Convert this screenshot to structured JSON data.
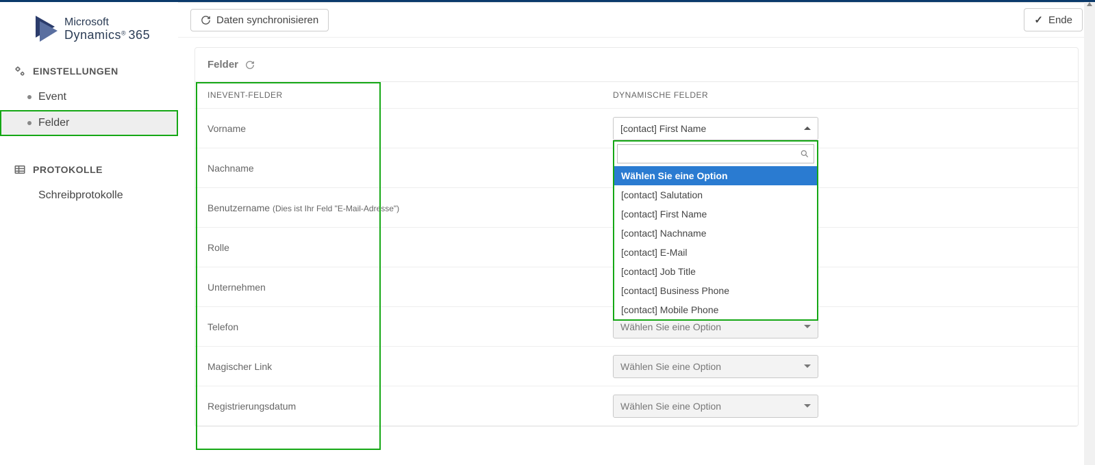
{
  "logo": {
    "line1": "Microsoft",
    "line2": "Dynamics",
    "line3": "365"
  },
  "sidebar": {
    "section1": {
      "title": "EINSTELLUNGEN",
      "items": [
        "Event",
        "Felder"
      ]
    },
    "section2": {
      "title": "PROTOKOLLE",
      "items": [
        "Schreibprotokolle"
      ]
    }
  },
  "toolbar": {
    "sync": "Daten synchronisieren",
    "end": "Ende"
  },
  "panel": {
    "title": "Felder",
    "col_left": "INEVENT-FELDER",
    "col_right": "DYNAMISCHE FELDER",
    "rows": [
      {
        "label": "Vorname",
        "value": "[contact] First Name",
        "open": true
      },
      {
        "label": "Nachname"
      },
      {
        "label": "Benutzername",
        "hint": "(Dies ist Ihr Feld \"E-Mail-Adresse\")"
      },
      {
        "label": "Rolle"
      },
      {
        "label": "Unternehmen"
      },
      {
        "label": "Telefon",
        "placeholder": "Wählen Sie eine Option"
      },
      {
        "label": "Magischer Link",
        "placeholder": "Wählen Sie eine Option"
      },
      {
        "label": "Registrierungsdatum",
        "placeholder": "Wählen Sie eine Option"
      }
    ]
  },
  "dropdown": {
    "options": [
      "Wählen Sie eine Option",
      "[contact] Salutation",
      "[contact] First Name",
      "[contact] Nachname",
      "[contact] E-Mail",
      "[contact] Job Title",
      "[contact] Business Phone",
      "[contact] Mobile Phone"
    ]
  }
}
